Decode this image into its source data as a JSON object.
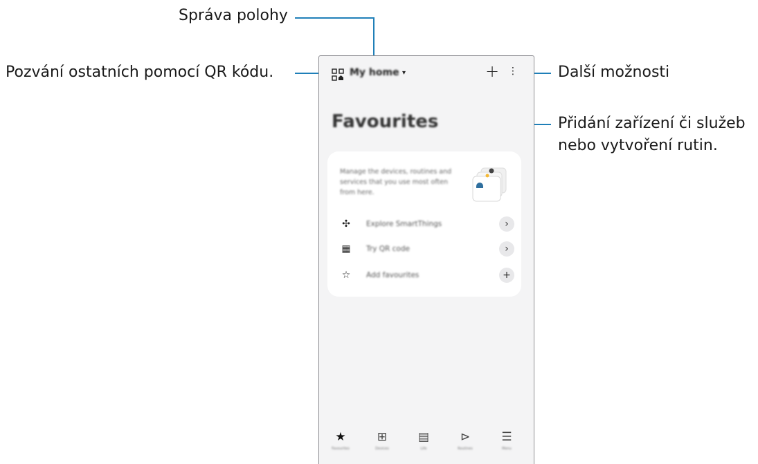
{
  "callouts": {
    "location": "Správa polohy",
    "qr_invite": "Pozvání ostatních pomocí QR kódu.",
    "more": "Další možnosti",
    "add_line1": "Přidání zařízení či služeb",
    "add_line2": "nebo vytvoření rutin."
  },
  "header": {
    "home_name": "My home",
    "caret": "▾",
    "add_icon": "+",
    "more_icon": "⋮"
  },
  "page": {
    "title": "Favourites"
  },
  "card": {
    "description": "Manage the devices, routines and services that you use most often from here.",
    "rows": [
      {
        "icon": "explore-icon",
        "glyph": "✣",
        "label": "Explore SmartThings",
        "action": "›"
      },
      {
        "icon": "qr-code-icon",
        "glyph": "▦",
        "label": "Try QR code",
        "action": "›"
      },
      {
        "icon": "star-outline-icon",
        "glyph": "☆",
        "label": "Add favourites",
        "action": "+"
      }
    ]
  },
  "nav": [
    {
      "icon": "star-icon",
      "glyph": "★",
      "label": "Favourites"
    },
    {
      "icon": "devices-icon",
      "glyph": "⊞",
      "label": "Devices"
    },
    {
      "icon": "life-icon",
      "glyph": "▤",
      "label": "Life"
    },
    {
      "icon": "routines-icon",
      "glyph": "⊳",
      "label": "Routines"
    },
    {
      "icon": "menu-icon",
      "glyph": "☰",
      "label": "Menu"
    }
  ]
}
